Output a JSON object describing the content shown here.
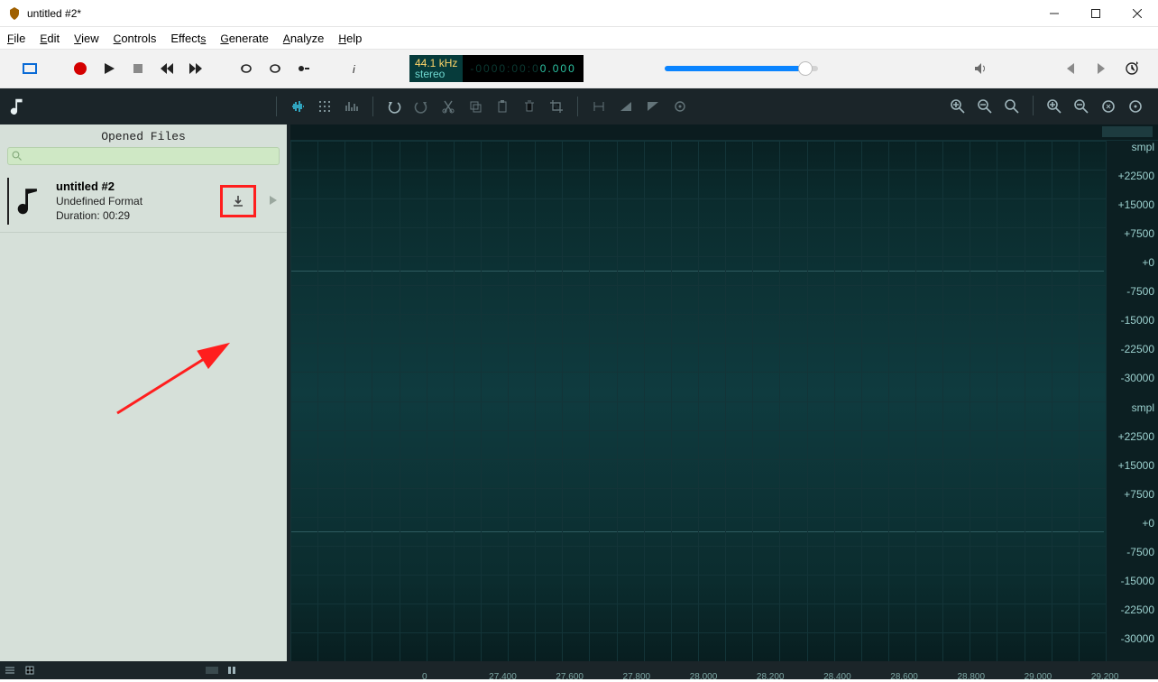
{
  "window": {
    "title": "untitled #2*"
  },
  "menu": {
    "file": "File",
    "edit": "Edit",
    "view": "View",
    "controls": "Controls",
    "effects": "Effects",
    "generate": "Generate",
    "analyze": "Analyze",
    "help": "Help"
  },
  "lcd": {
    "rate": "44.1 kHz",
    "channels": "stereo",
    "time_dim": "-0000:00:0",
    "time_bright": "0.000"
  },
  "sidebar": {
    "header": "Opened Files",
    "search_placeholder": "",
    "file": {
      "name": "untitled #2",
      "format": "Undefined Format",
      "duration_label": "Duration: 00:29"
    }
  },
  "amp_labels_top": [
    "smpl",
    "+22500",
    "+15000",
    "+7500",
    "+0",
    "-7500",
    "-15000",
    "-22500",
    "-30000",
    "smpl"
  ],
  "amp_labels_bot": [
    "+22500",
    "+15000",
    "+7500",
    "+0",
    "-7500",
    "-15000",
    "-22500",
    "-30000"
  ],
  "timeline_ticks": [
    "0",
    "27.400",
    "27.600",
    "27.800",
    "28.000",
    "28.200",
    "28.400",
    "28.600",
    "28.800",
    "29.000",
    "29.200"
  ],
  "colors": {
    "accent": "#0a84ff",
    "highlight_box": "#ff1e1e"
  }
}
